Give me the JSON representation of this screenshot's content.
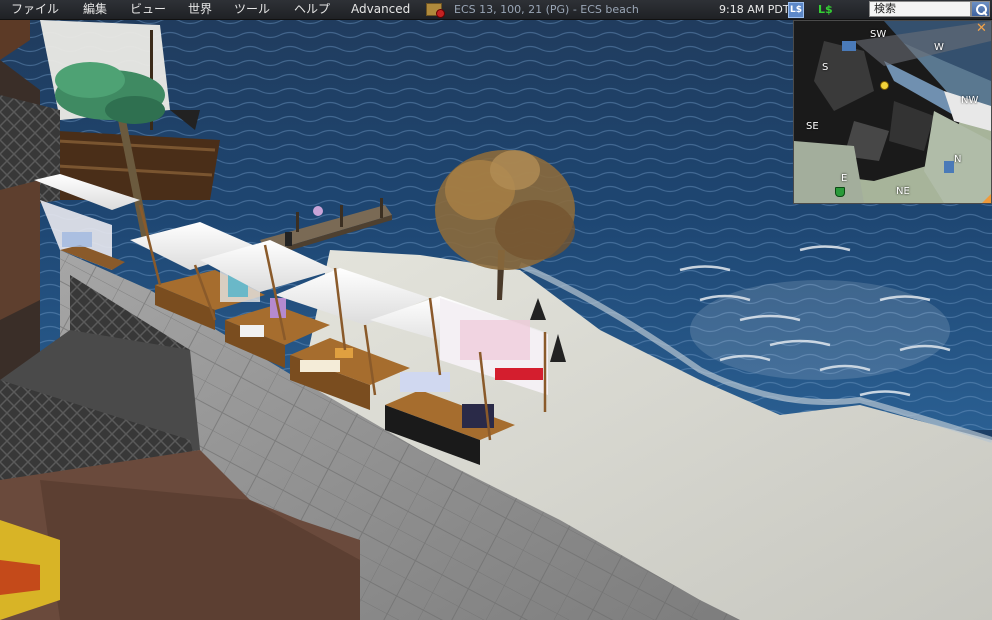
{
  "menubar": {
    "items": [
      "ファイル",
      "編集",
      "ビュー",
      "世界",
      "ツール",
      "ヘルプ",
      "Advanced"
    ],
    "location": "ECS 13, 100, 21 (PG) - ECS beach",
    "clock": "9:18 AM PDT",
    "ls_button": "L$",
    "balance": "L$",
    "search_placeholder": "検索"
  },
  "minimap": {
    "compass": {
      "sw": "SW",
      "w": "W",
      "s": "S",
      "nw": "NW",
      "se": "SE",
      "n": "N",
      "e": "E",
      "ne": "NE"
    },
    "close_icon": "close-icon",
    "accent_color": "#f09a3a"
  },
  "scene": {
    "description_colors": {
      "sea": "#1f4872",
      "sand": "#d8d8d2",
      "pavement": "#8f8f8f",
      "tent_canvas": "#f6f6f6"
    },
    "tent_signs": [
      "",
      "",
      "",
      ""
    ]
  }
}
